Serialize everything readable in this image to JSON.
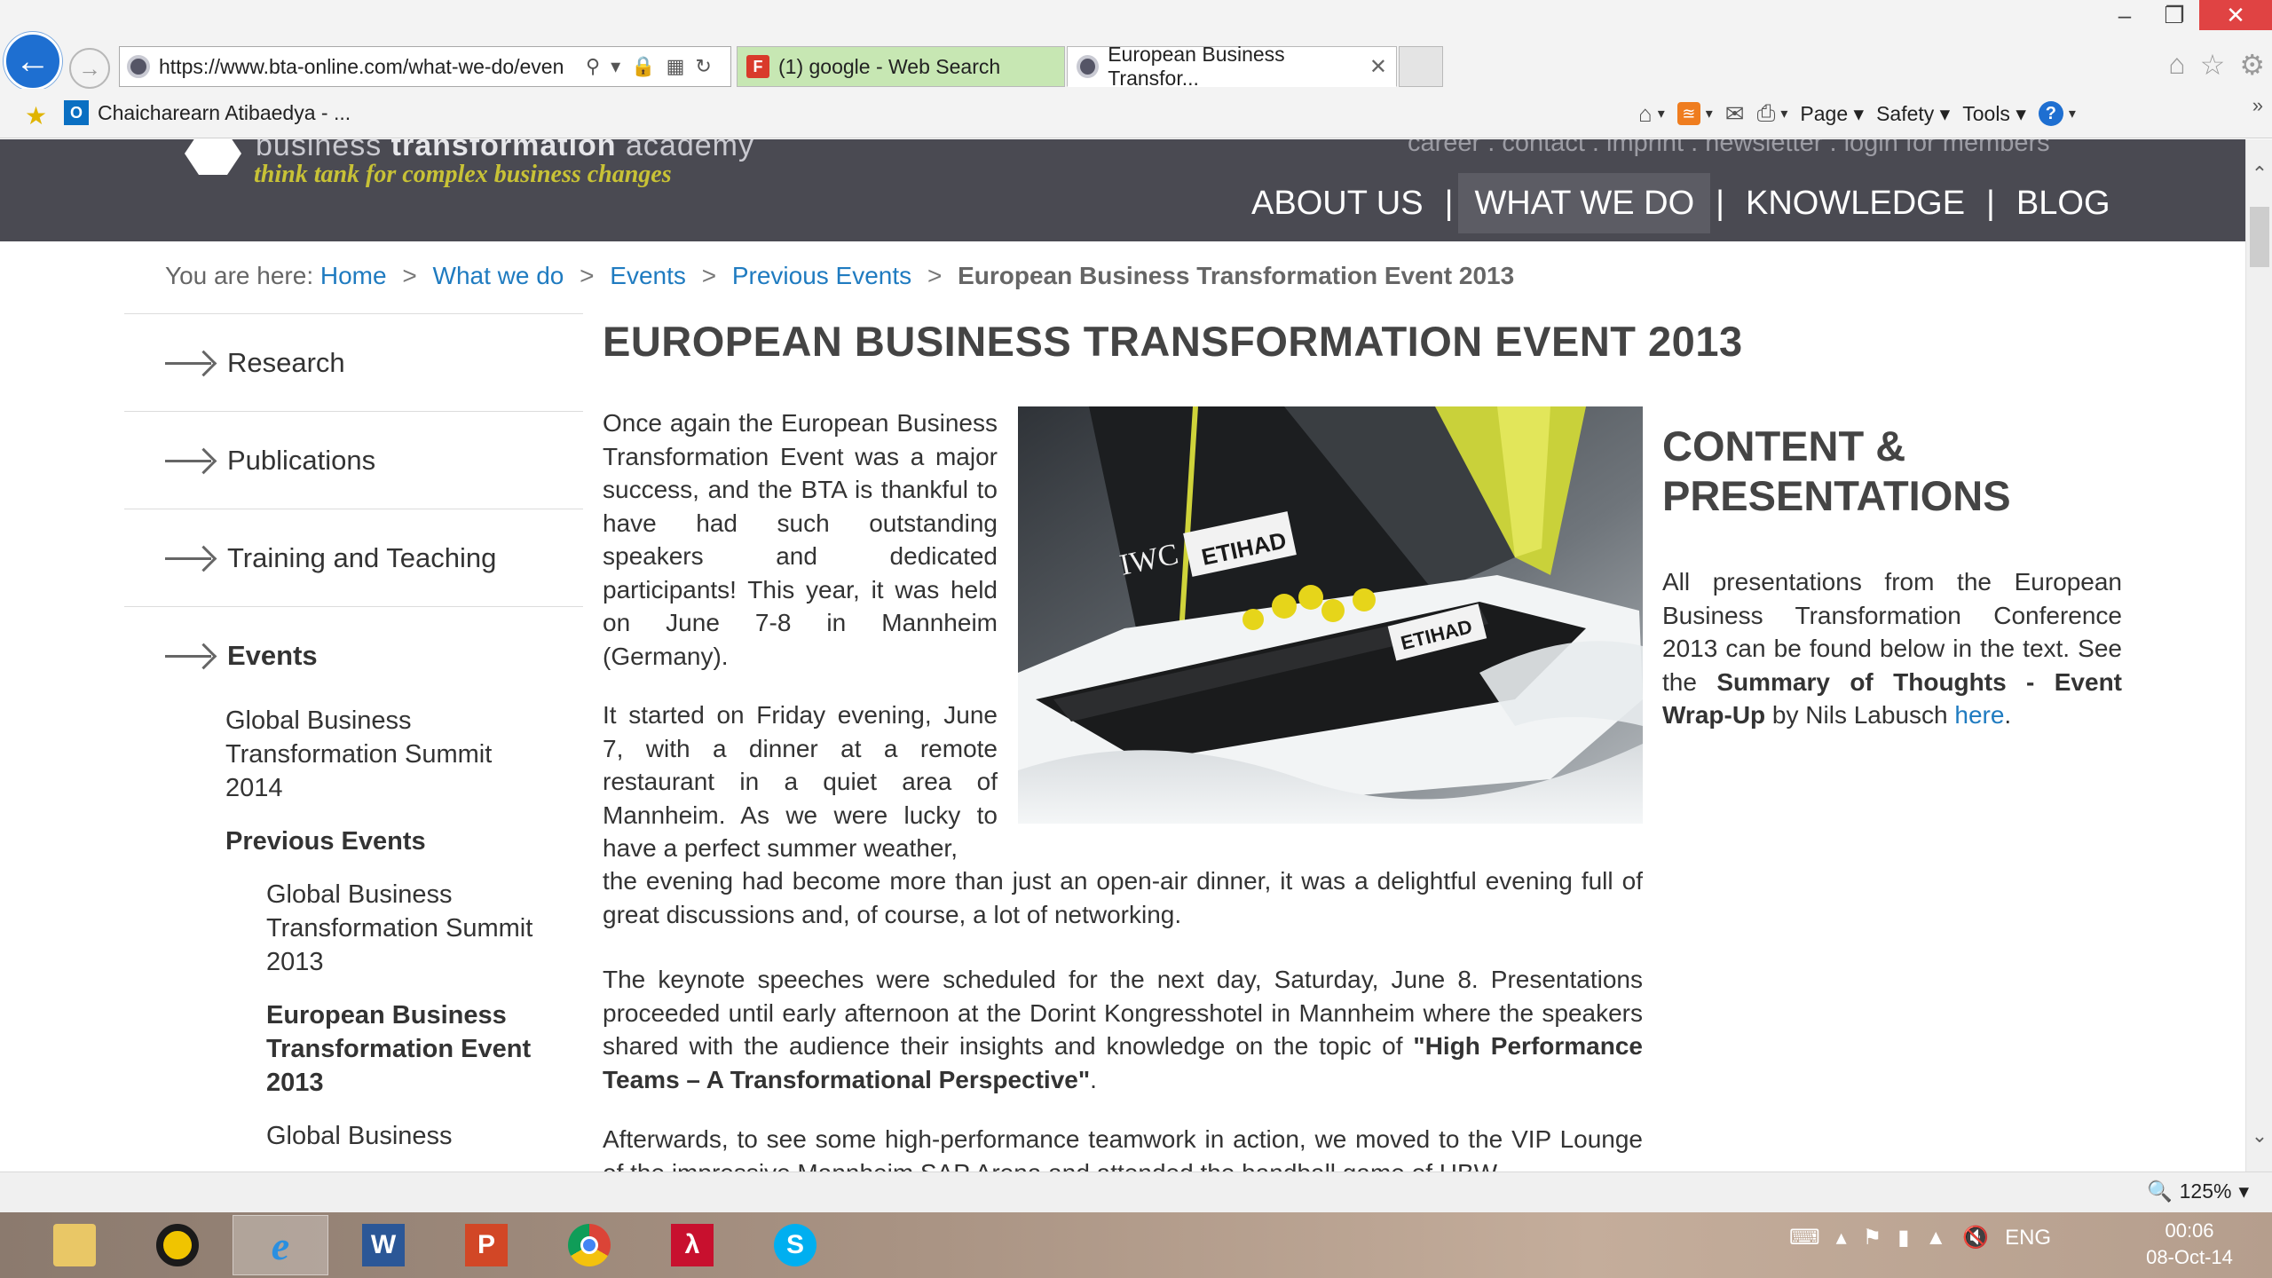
{
  "browser": {
    "url": "https://www.bta-online.com/what-we-do/even",
    "tabs": [
      {
        "label": "(1) google - Web Search"
      },
      {
        "label": "European Business Transfor..."
      }
    ],
    "favorite_item": "Chaicharearn Atibaedya - ...",
    "commands": {
      "page": "Page",
      "safety": "Safety",
      "tools": "Tools"
    },
    "zoom": "125%"
  },
  "site": {
    "logo_name_light": "business ",
    "logo_name_bold": "transformation",
    "logo_name_end": " academy",
    "tagline": "think tank for complex business changes",
    "top_links": "career . contact . imprint . newsletter . login for members",
    "nav": [
      "ABOUT US",
      "WHAT WE DO",
      "KNOWLEDGE",
      "BLOG"
    ],
    "nav_separator": "|"
  },
  "breadcrumb": {
    "prefix": "You are here:",
    "links": [
      "Home",
      "What we do",
      "Events",
      "Previous Events"
    ],
    "current": "European Business Transformation Event 2013",
    "separator": ">"
  },
  "sidebar": {
    "items": [
      "Research",
      "Publications",
      "Training and Teaching",
      "Events"
    ],
    "sub": {
      "gbts2014": "Global Business Transformation Summit 2014",
      "previous": "Previous Events",
      "gbts2013": "Global Business Transformation Summit 2013",
      "ebte2013": "European Business Transformation Event 2013",
      "gb_partial": "Global Business"
    }
  },
  "article": {
    "title": "EUROPEAN BUSINESS TRANSFORMATION EVENT 2013",
    "p1": "Once again the European Business Transformation Event was a major success, and the BTA is thankful to have had such outstanding speakers and dedicated participants! This year, it was held on June 7-8 in Mannheim (Germany).",
    "p2_top": "It started on Friday evening, June 7, with a dinner at a remote restaurant in a quiet area of Mannheim. As we were lucky to have a perfect summer weather,",
    "p2_bottom": "the evening had become more than just an open-air dinner, it was a delightful evening full of great discussions and, of course, a lot of networking.",
    "p3_text": "The keynote speeches were scheduled for the next day, Saturday, June 8. Presentations proceeded until early afternoon at the Dorint Kongresshotel in Mannheim where the speakers shared with the audience their insights and knowledge on the topic of ",
    "p3_bold": "\"High Performance Teams – A Transformational Perspective\"",
    "p3_end": ".",
    "p4": "Afterwards, to see some high-performance teamwork in action, we moved to the VIP Lounge of the impressive Mannheim SAP Arena and attended the handball game of HBW",
    "image_text": {
      "sponsor_left": "IWC",
      "sponsor_right": "ETIHAD",
      "hull": "ETIHAD"
    }
  },
  "right": {
    "title": "CONTENT & PRESENTATIONS",
    "text_start": "All presentations from the European Business Transformation Conference 2013 can be found below in the text. See the ",
    "bold": "Summary of Thoughts - Event Wrap-Up",
    "text_mid": " by Nils Labusch ",
    "link": "here",
    "text_end": "."
  },
  "taskbar": {
    "word": "W",
    "powerpoint": "P",
    "skype": "S",
    "lang": "ENG",
    "time": "00:06",
    "date": "08-Oct-14"
  },
  "colors": {
    "header_bg": "#4a4a52",
    "tagline": "#c8c236",
    "link": "#1f7bc0",
    "google_tab": "#c7e7b3"
  }
}
